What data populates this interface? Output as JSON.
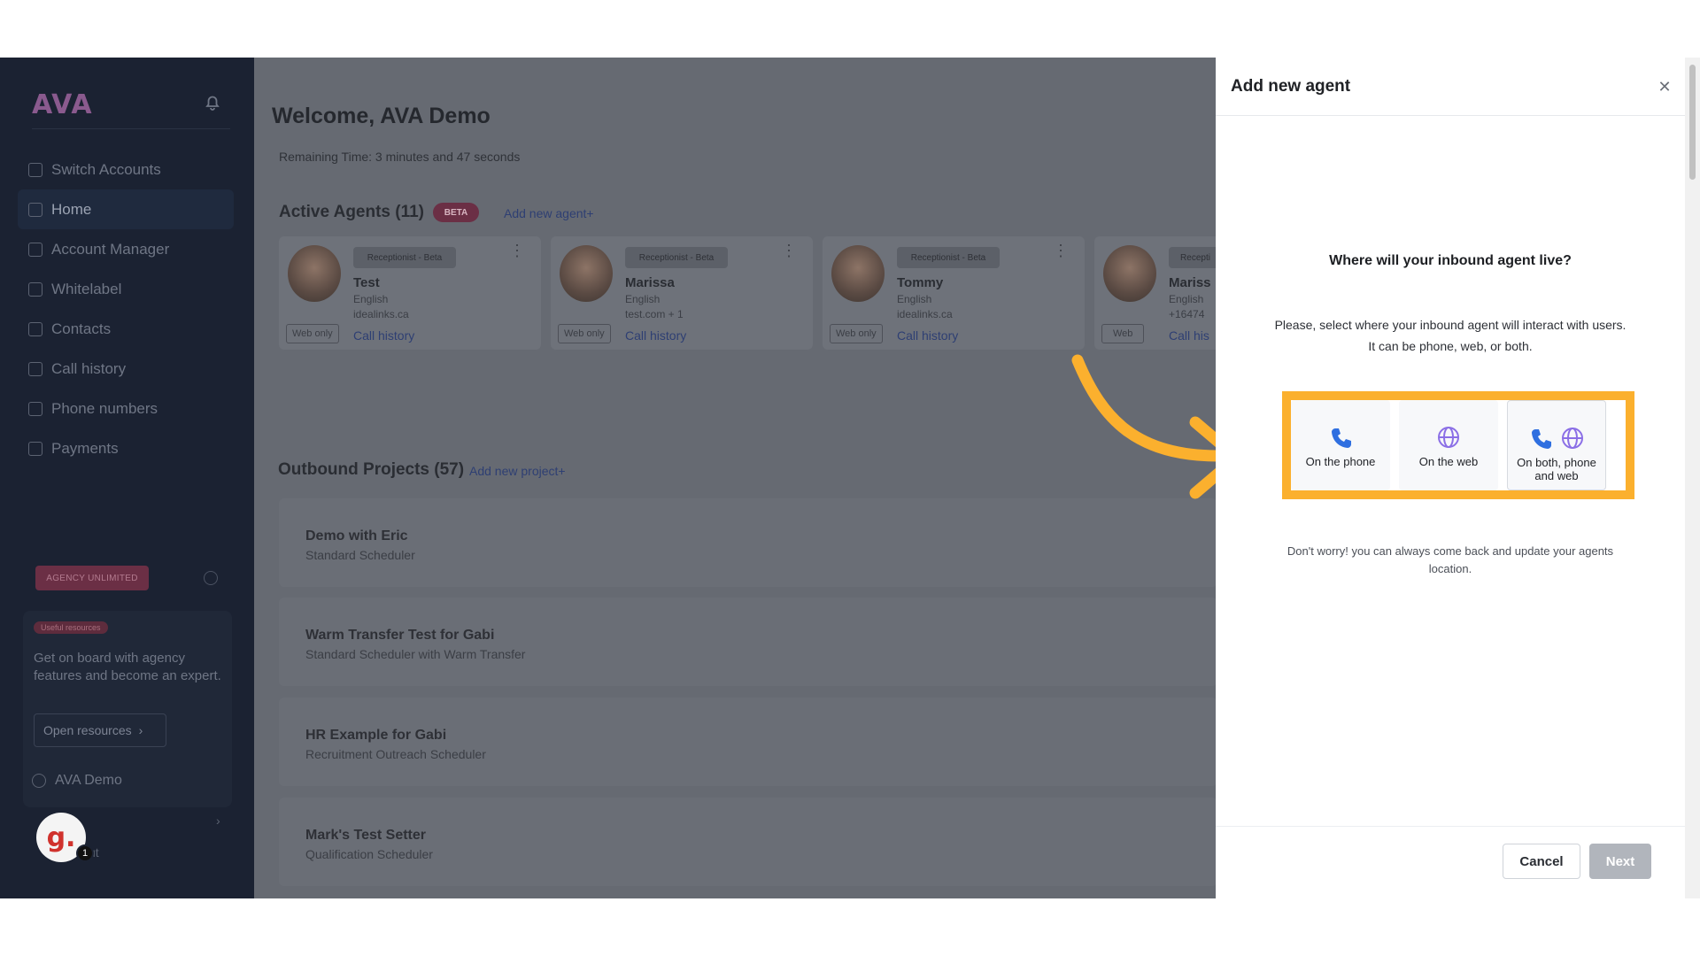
{
  "sidebar": {
    "logo": "AVA",
    "items": [
      {
        "label": "Switch Accounts"
      },
      {
        "label": "Home"
      },
      {
        "label": "Account Manager"
      },
      {
        "label": "Whitelabel"
      },
      {
        "label": "Contacts"
      },
      {
        "label": "Call history"
      },
      {
        "label": "Phone numbers"
      },
      {
        "label": "Payments"
      }
    ],
    "plan_badge": "AGENCY UNLIMITED",
    "resources": {
      "badge": "Useful resources",
      "text": "Get on board with agency features and become an expert.",
      "button": "Open resources"
    },
    "user": "AVA Demo",
    "logout": "ut",
    "avatar_letter": "g.",
    "notification_count": "1"
  },
  "main": {
    "welcome": "Welcome, AVA Demo",
    "remaining": "Remaining Time: 3 minutes and 47 seconds",
    "active_agents": {
      "title": "Active Agents (11)",
      "badge": "BETA",
      "add_link": "Add new agent+",
      "cards": [
        {
          "tag": "Receptionist - Beta",
          "name": "Test",
          "lang": "English",
          "site": "idealinks.ca",
          "mode": "Web only",
          "history": "Call history"
        },
        {
          "tag": "Receptionist - Beta",
          "name": "Marissa",
          "lang": "English",
          "site": "test.com + 1",
          "mode": "Web only",
          "history": "Call history"
        },
        {
          "tag": "Receptionist - Beta",
          "name": "Tommy",
          "lang": "English",
          "site": "idealinks.ca",
          "mode": "Web only",
          "history": "Call history"
        },
        {
          "tag": "Recepti",
          "name": "Mariss",
          "lang": "English",
          "site": "+16474",
          "mode": "Web",
          "history": "Call his"
        }
      ]
    },
    "outbound": {
      "title": "Outbound Projects (57)",
      "add_link": "Add new project+",
      "projects": [
        {
          "title": "Demo with Eric",
          "sub": "Standard Scheduler"
        },
        {
          "title": "Warm Transfer Test for Gabi",
          "sub": "Standard Scheduler with Warm Transfer"
        },
        {
          "title": "HR Example for Gabi",
          "sub": "Recruitment Outreach Scheduler"
        },
        {
          "title": "Mark's Test Setter",
          "sub": "Qualification Scheduler"
        }
      ]
    }
  },
  "modal": {
    "title": "Add new agent",
    "heading": "Where will your inbound agent live?",
    "description": "Please, select where your inbound agent will interact with users. It can be phone, web, or both.",
    "options": [
      {
        "label": "On the phone",
        "icons": [
          "phone-icon"
        ]
      },
      {
        "label": "On the web",
        "icons": [
          "globe-icon"
        ]
      },
      {
        "label": "On both, phone and web",
        "icons": [
          "phone-icon",
          "globe-icon"
        ]
      }
    ],
    "note": "Don't worry! you can always come back and update your agents location.",
    "cancel": "Cancel",
    "next": "Next"
  },
  "colors": {
    "highlight": "#fbb02e",
    "sidebar_bg": "#1b2232",
    "overlay": "#666a72",
    "phone_blue": "#2f6fe0",
    "globe_purple": "#8b6fe6"
  }
}
